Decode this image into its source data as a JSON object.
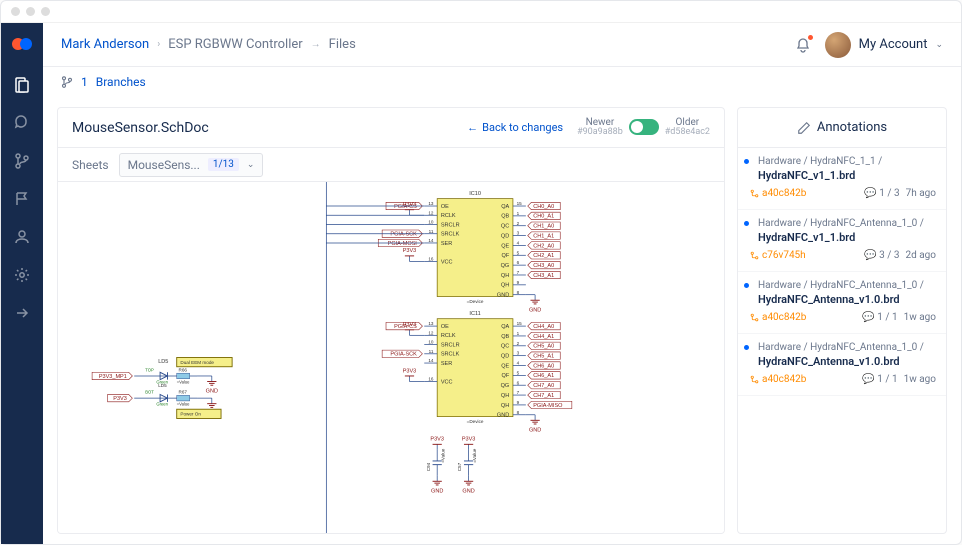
{
  "breadcrumb": {
    "user": "Mark Anderson",
    "project": "ESP RGBWW Controller",
    "section": "Files"
  },
  "account_label": "My Account",
  "subbar": {
    "count": "1",
    "label": "Branches"
  },
  "doc": {
    "title": "MouseSensor.SchDoc",
    "back_label": "Back to changes",
    "newer_label": "Newer",
    "newer_hash": "#90a9a88b",
    "older_label": "Older",
    "older_hash": "#d58e4ac2",
    "sheets_label": "Sheets",
    "sheet_selected": "MouseSens...",
    "sheet_count": "1/13"
  },
  "annotations": {
    "header": "Annotations",
    "items": [
      {
        "path": "Hardware / HydraNFC_1_1 /",
        "file": "HydraNFC_v1_1.brd",
        "hash": "a40c842b",
        "count": "1 / 3",
        "time": "7h ago"
      },
      {
        "path": "Hardware / HydraNFC_Antenna_1_0 /",
        "file": "HydraNFC_v1_1.brd",
        "hash": "c76v745h",
        "count": "3 / 3",
        "time": "2d ago"
      },
      {
        "path": "Hardware / HydraNFC_Antenna_1_0 /",
        "file": "HydraNFC_Antenna_v1.0.brd",
        "hash": "a40c842b",
        "count": "1 / 1",
        "time": "1w ago"
      },
      {
        "path": "Hardware / HydraNFC_Antenna_1_0 /",
        "file": "HydraNFC_Antenna_v1.0.brd",
        "hash": "a40c842b",
        "count": "1 / 1",
        "time": "1w ago"
      }
    ]
  },
  "schematic": {
    "ic10": {
      "ref": "IC10",
      "footer": "=Device",
      "left": [
        {
          "n": "13",
          "t": "OE"
        },
        {
          "n": "12",
          "t": "RCLK"
        },
        {
          "n": "10",
          "t": "SRCLR"
        },
        {
          "n": "11",
          "t": "SRCLK"
        },
        {
          "n": "14",
          "t": "SER"
        },
        {
          "n": "",
          "t": ""
        },
        {
          "n": "16",
          "t": "VCC"
        }
      ],
      "right": [
        {
          "n": "15",
          "t": "QA"
        },
        {
          "n": "1",
          "t": "QB"
        },
        {
          "n": "2",
          "t": "QC"
        },
        {
          "n": "3",
          "t": "QD"
        },
        {
          "n": "4",
          "t": "QE"
        },
        {
          "n": "5",
          "t": "QF"
        },
        {
          "n": "6",
          "t": "QG"
        },
        {
          "n": "7",
          "t": "QH"
        },
        {
          "n": "9",
          "t": "QH"
        },
        {
          "n": "8",
          "t": "GND"
        }
      ],
      "sig_left": [
        "PGIA-CS",
        "P3V3",
        "",
        "PGIA-SCK",
        "PGIA-MOSI",
        "",
        "P3V3"
      ],
      "sig_right": [
        "CH0_A0",
        "CH0_A1",
        "CH1_A0",
        "CH1_A1",
        "CH2_A0",
        "CH2_A1",
        "CH3_A0",
        "CH3_A1",
        "",
        "GND"
      ]
    },
    "ic11": {
      "ref": "IC11",
      "footer": "=Device",
      "left": [
        {
          "n": "13",
          "t": "OE"
        },
        {
          "n": "12",
          "t": "RCLK"
        },
        {
          "n": "10",
          "t": "SRCLR"
        },
        {
          "n": "11",
          "t": "SRCLK"
        },
        {
          "n": "14",
          "t": "SER"
        },
        {
          "n": "",
          "t": ""
        },
        {
          "n": "16",
          "t": "VCC"
        }
      ],
      "right": [
        {
          "n": "15",
          "t": "QA"
        },
        {
          "n": "1",
          "t": "QB"
        },
        {
          "n": "2",
          "t": "QC"
        },
        {
          "n": "3",
          "t": "QD"
        },
        {
          "n": "4",
          "t": "QE"
        },
        {
          "n": "5",
          "t": "QF"
        },
        {
          "n": "6",
          "t": "QG"
        },
        {
          "n": "7",
          "t": "QH"
        },
        {
          "n": "9",
          "t": "QH"
        },
        {
          "n": "8",
          "t": "GND"
        }
      ],
      "sig_left": [
        "PGIA-CS",
        "P3V3",
        "",
        "PGIA-SCK",
        "",
        "",
        "P3V3"
      ],
      "sig_right": [
        "CH4_A0",
        "CH4_A1",
        "CH5_A0",
        "CH5_A1",
        "CH6_A0",
        "CH6_A1",
        "CH7_A0",
        "CH7_A1",
        "PGIA-MISO",
        "GND"
      ]
    },
    "leds": {
      "ld5": "LD5",
      "dual": "Dual EEM mode",
      "r66": "R66",
      "r67": "R67",
      "top": "TOP",
      "bot": "BOT",
      "gnd": "GND",
      "p1": "P3V3_MP1",
      "p2": "P3V3",
      "pwr": "Power On",
      "val": "=Value",
      "grn": "Green",
      "ld5b": "LD5"
    },
    "caps": {
      "c94": "C94",
      "c57": "C57",
      "p3v3": "P3V3",
      "gnd": "GND",
      "val": "=Value"
    }
  }
}
